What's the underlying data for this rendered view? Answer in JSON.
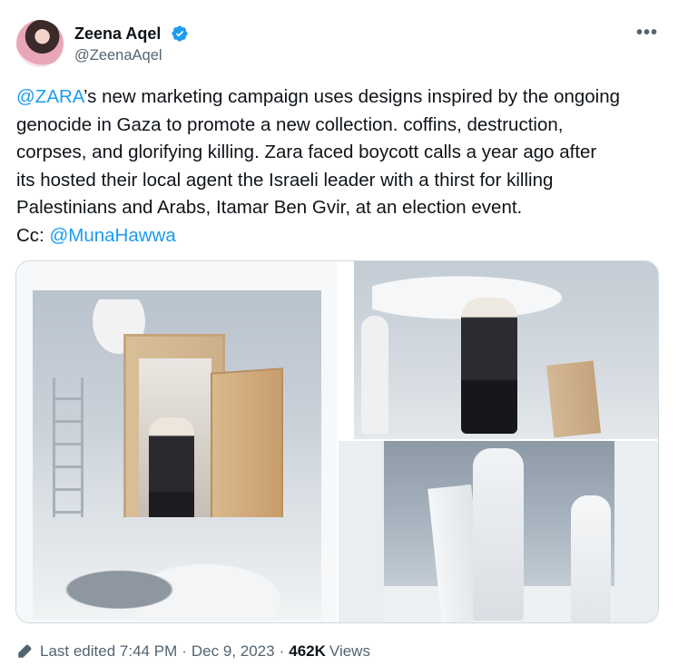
{
  "author": {
    "name": "Zeena Aqel",
    "handle": "@ZeenaAqel",
    "verified": true
  },
  "menu": {
    "more_label": "•••"
  },
  "tweet": {
    "lines": [
      {
        "mention": "@ZARA",
        "text": "’s new marketing campaign uses  designs inspired by the ongoing"
      },
      {
        "text": "genocide in Gaza to promote a new collection. coffins, destruction,"
      },
      {
        "text": "corpses, and glorifying killing. Zara faced boycott calls a year ago after"
      },
      {
        "text": "its hosted their local agent the Israeli leader with a thirst for killing"
      },
      {
        "text": "Palestinians and Arabs, Itamar Ben Gvir, at an election event."
      },
      {
        "prefix": "Cc: ",
        "mention": "@MunaHawwa"
      }
    ]
  },
  "footer": {
    "edited_label": "Last edited",
    "time": "7:44 PM",
    "date": "Dec 9, 2023",
    "views_count": "462K",
    "views_label": "Views",
    "separator": "·"
  },
  "colors": {
    "link": "#1d9bf0",
    "secondary_text": "#536471",
    "primary_text": "#0f1419",
    "verified_badge": "#1d9bf0"
  }
}
